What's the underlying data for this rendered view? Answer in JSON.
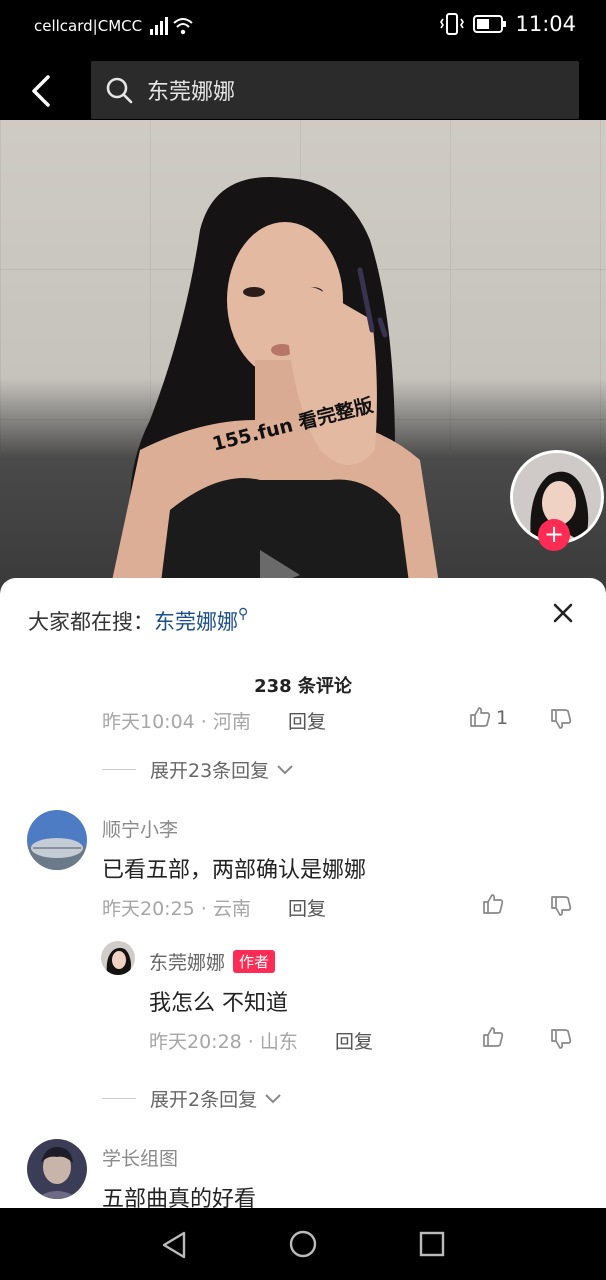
{
  "status_bar": {
    "carrier": "cellcard|CMCC",
    "time": "11:04"
  },
  "search": {
    "query": "东莞娜娜"
  },
  "video": {
    "watermark": "155.fun 看完整版"
  },
  "comments_panel": {
    "hot_search_label": "大家都在搜：",
    "hot_search_term": "东莞娜娜",
    "count_label": "238 条评论",
    "first_item": {
      "meta": "昨天10:04 · 河南",
      "reply": "回复",
      "likes": "1",
      "expand": "展开23条回复"
    },
    "comments": [
      {
        "user": "顺宁小李",
        "text": "已看五部，两部确认是娜娜",
        "meta": "昨天20:25 · 云南",
        "reply": "回复",
        "sub_reply": {
          "user": "东莞娜娜",
          "badge": "作者",
          "text": "我怎么 不知道",
          "meta": "昨天20:28 · 山东",
          "reply": "回复"
        },
        "expand": "展开2条回复"
      },
      {
        "user": "学长组图",
        "text": "五部曲真的好看"
      }
    ]
  },
  "colors": {
    "accent": "#fe2c55",
    "link": "#1c4f8a"
  }
}
